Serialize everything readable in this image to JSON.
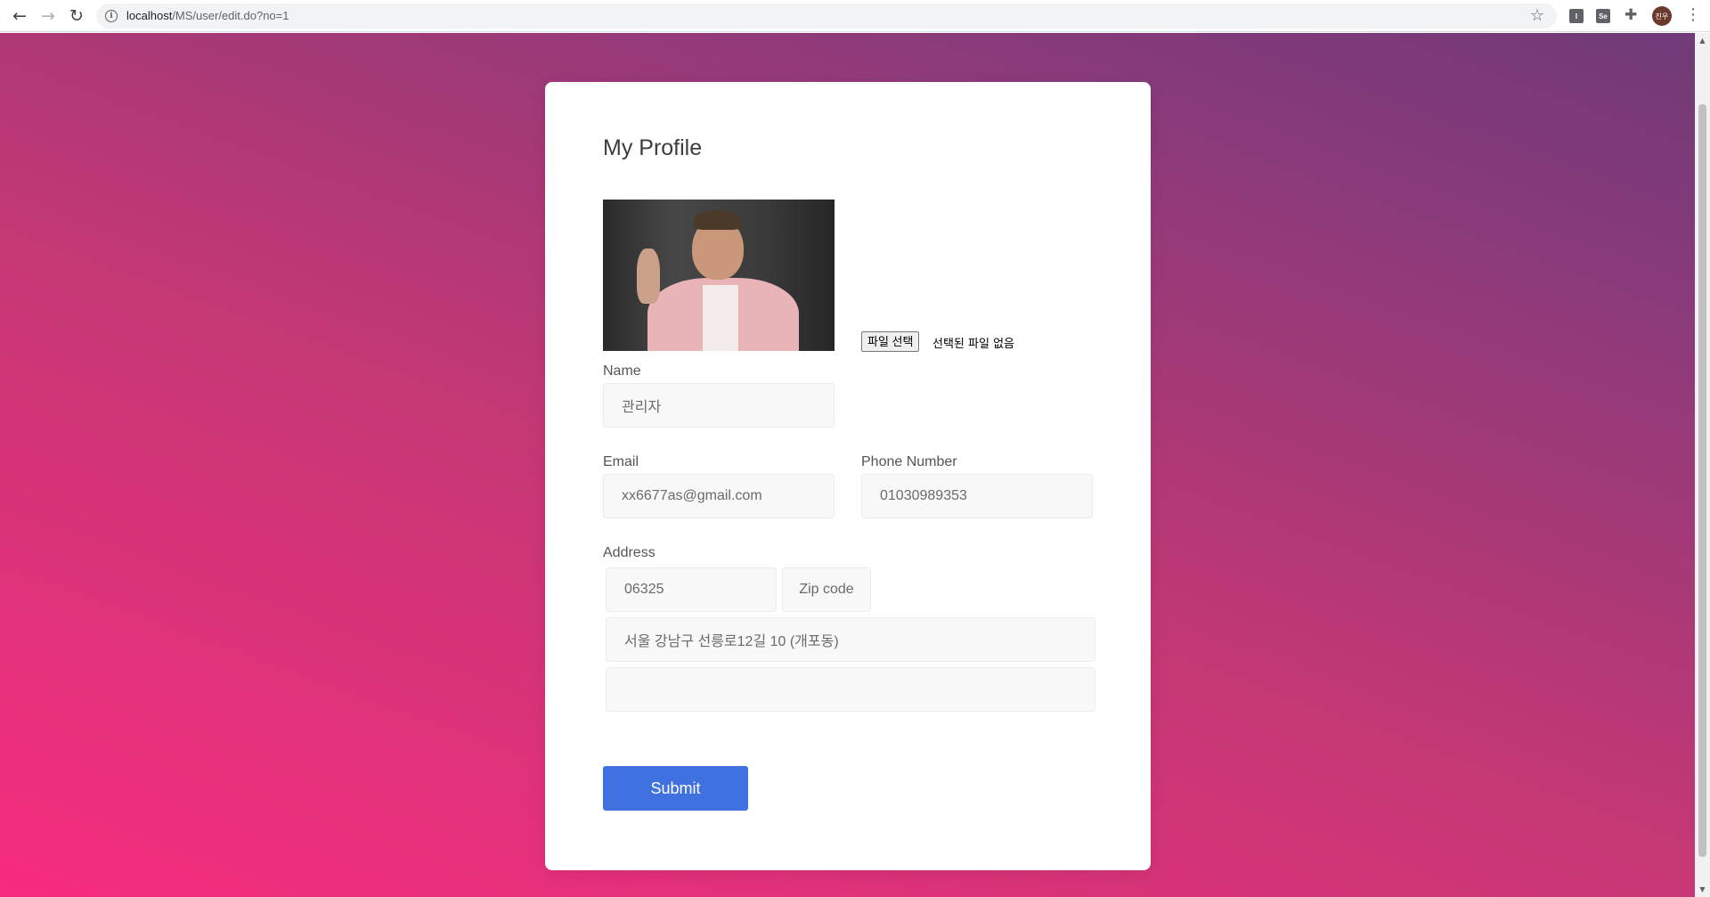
{
  "browser": {
    "url_host": "localhost",
    "url_path": "/MS/user/edit.do?no=1",
    "avatar_text": "진우",
    "extension_1_label": "I",
    "extension_2_label": "Se"
  },
  "profile": {
    "title": "My Profile",
    "file_button_label": "파일 선택",
    "file_status": "선택된 파일 없음",
    "name_label": "Name",
    "name_value": "관리자",
    "email_label": "Email",
    "email_value": "xx6677as@gmail.com",
    "phone_label": "Phone Number",
    "phone_value": "01030989353",
    "address_label": "Address",
    "zip_value": "06325",
    "zip_button_label": "Zip code",
    "address_line1": "서울 강남구 선릉로12길 10 (개포동)",
    "address_line2": "",
    "submit_label": "Submit"
  },
  "colors": {
    "submit_button": "#3f72e0",
    "background_gradient_start": "#f72c7e",
    "background_gradient_end": "#703a78"
  },
  "icons": {
    "back": "arrow-left",
    "forward": "arrow-right",
    "reload": "reload",
    "site_info": "info-circle",
    "bookmark": "star",
    "extensions": "puzzle",
    "menu": "kebab"
  }
}
